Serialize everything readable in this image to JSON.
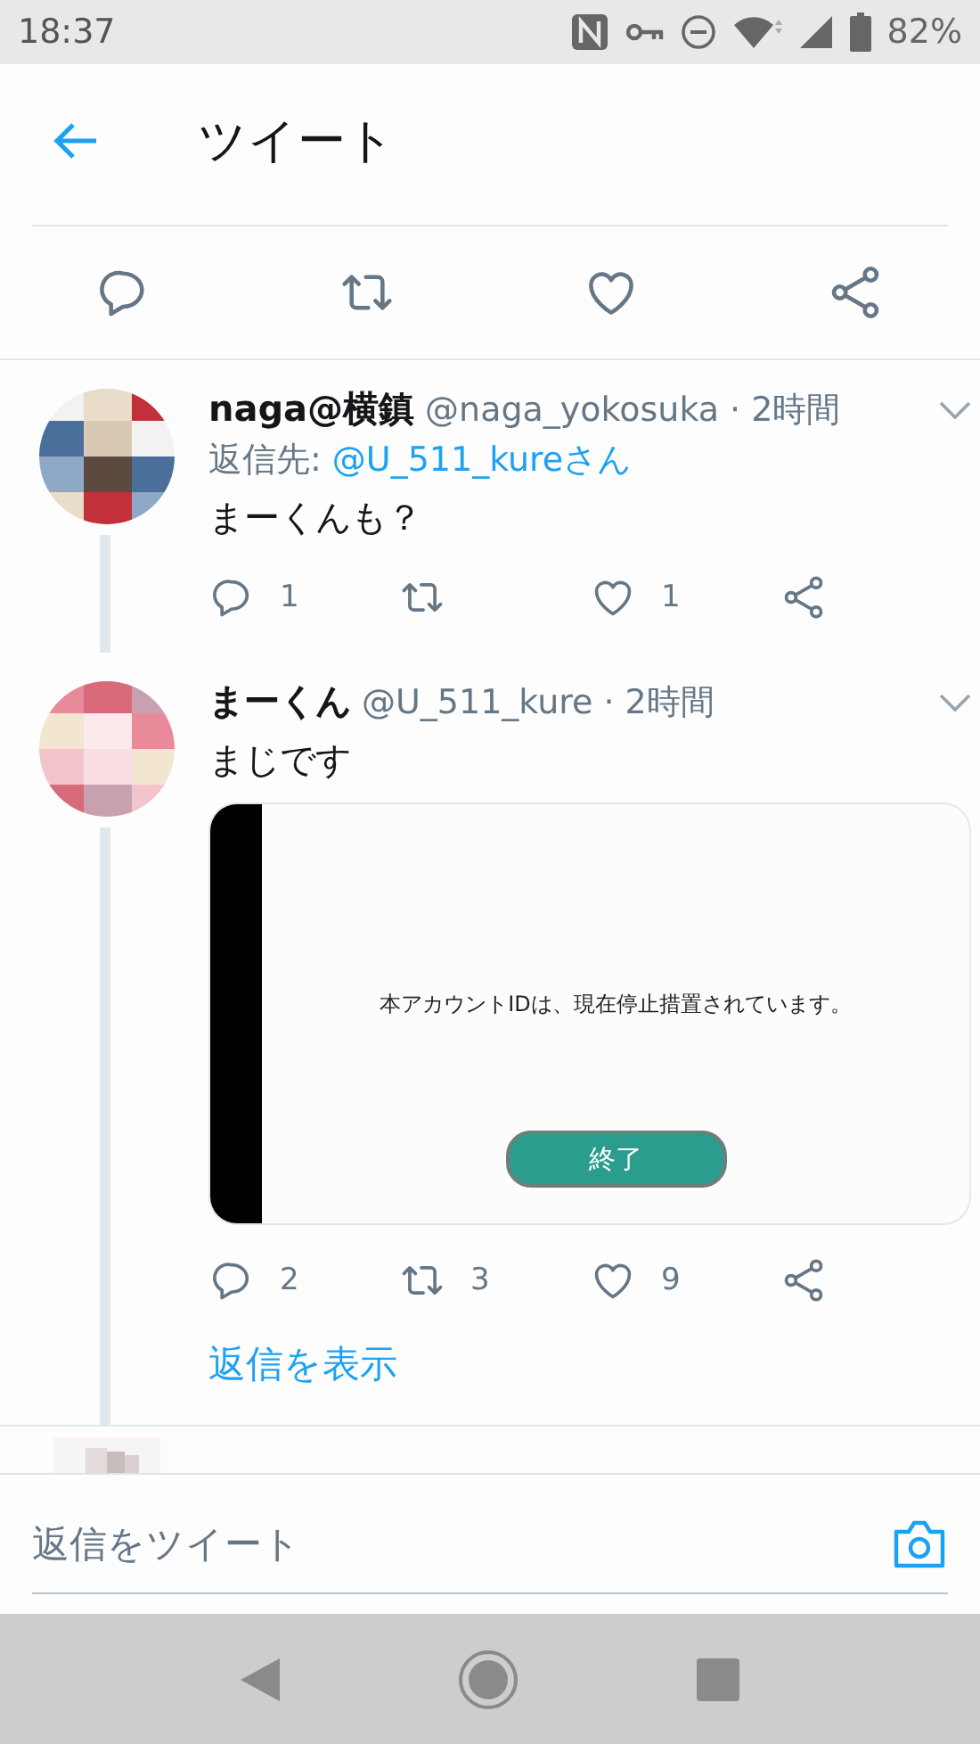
{
  "status_bar": {
    "time": "18:37",
    "battery": "82%"
  },
  "header": {
    "title": "ツイート"
  },
  "top_actions": [
    {
      "kind": "reply"
    },
    {
      "kind": "retweet"
    },
    {
      "kind": "like"
    },
    {
      "kind": "share"
    }
  ],
  "tweets": [
    {
      "name": "naga@横鎮",
      "handle": "@naga_yokosuka",
      "time": "· 2時間",
      "reply_to_label": "返信先: ",
      "reply_to": "@U_511_kureさん",
      "text": "まーくんも？",
      "actions": [
        {
          "kind": "reply",
          "count": "1"
        },
        {
          "kind": "retweet"
        },
        {
          "kind": "like",
          "count": "1"
        },
        {
          "kind": "share"
        }
      ]
    },
    {
      "name": "まーくん",
      "handle": "@U_511_kure",
      "time": "· 2時間",
      "text": "まじです",
      "media": {
        "message": "本アカウントIDは、現在停止措置されています。",
        "button": "終了"
      },
      "actions": [
        {
          "kind": "reply",
          "count": "2"
        },
        {
          "kind": "retweet",
          "count": "3"
        },
        {
          "kind": "like",
          "count": "9"
        },
        {
          "kind": "share"
        }
      ],
      "show_replies": "返信を表示"
    }
  ],
  "reply_field": {
    "placeholder": "返信をツイート"
  }
}
